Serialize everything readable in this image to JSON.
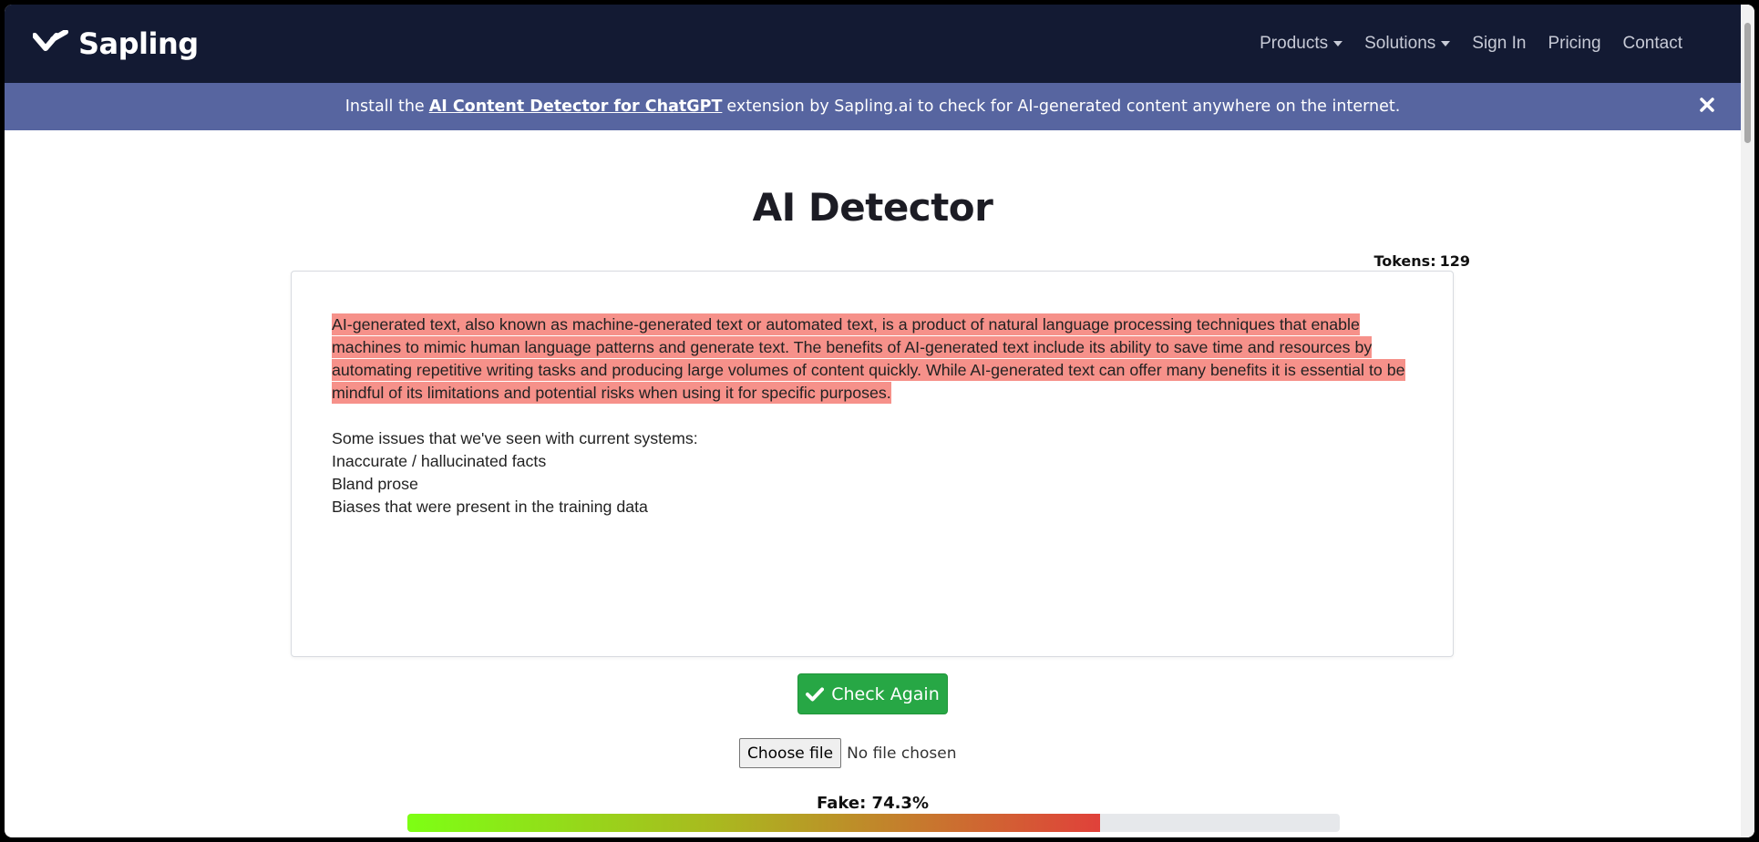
{
  "brand": {
    "name": "Sapling"
  },
  "nav": {
    "items": [
      {
        "label": "Products",
        "dropdown": true
      },
      {
        "label": "Solutions",
        "dropdown": true
      },
      {
        "label": "Sign In",
        "dropdown": false
      },
      {
        "label": "Pricing",
        "dropdown": false
      },
      {
        "label": "Contact",
        "dropdown": false
      }
    ]
  },
  "banner": {
    "prefix": "Install the",
    "link": "AI Content Detector for ChatGPT",
    "suffix": "extension by Sapling.ai to check for AI-generated content anywhere on the internet."
  },
  "page": {
    "title": "AI Detector"
  },
  "tokens": {
    "label": "Tokens:",
    "value": "129"
  },
  "editor": {
    "highlighted_paragraph": "AI-generated text, also known as machine-generated text or automated text, is a product of natural language processing techniques that enable machines to mimic human language patterns and generate text. The benefits of AI-generated text include its ability to save time and resources by automating repetitive writing tasks and producing large volumes of content quickly. While AI-generated text can offer many benefits it is essential to be mindful of its limitations and potential risks when using it for specific purposes.",
    "lines": [
      "Some issues that we've seen with current systems:",
      "Inaccurate / hallucinated facts",
      "Bland prose",
      "Biases that were present in the training data"
    ],
    "highlight_color": "#f6918a"
  },
  "actions": {
    "check_label": "Check Again"
  },
  "file_input": {
    "button_label": "Choose file",
    "status": "No file chosen"
  },
  "result": {
    "label": "Fake: 74.3%",
    "fake_fraction": 0.743
  },
  "colors": {
    "navbar": "#131a33",
    "banner": "#5765a0",
    "button": "#27a745"
  }
}
